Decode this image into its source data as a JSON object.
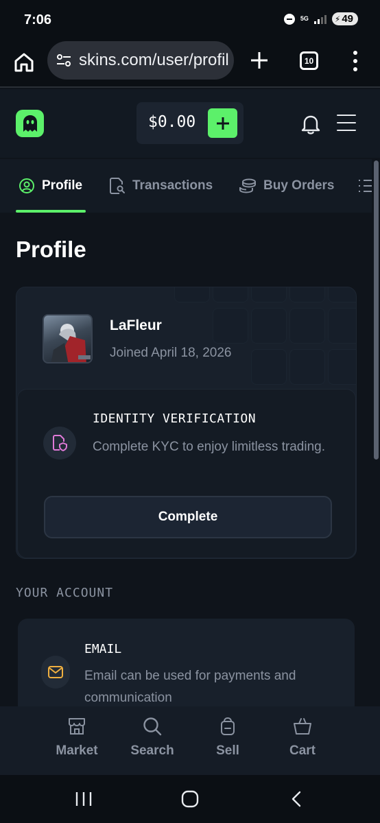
{
  "status": {
    "time": "7:06",
    "network": "5G",
    "battery": "49"
  },
  "browser": {
    "url": "skins.com/user/profil",
    "tab_count": "10"
  },
  "header": {
    "balance": "$0.00"
  },
  "tabs": [
    {
      "label": "Profile",
      "active": true,
      "icon": "user-circle-icon"
    },
    {
      "label": "Transactions",
      "active": false,
      "icon": "document-search-icon"
    },
    {
      "label": "Buy Orders",
      "active": false,
      "icon": "coins-icon"
    }
  ],
  "page": {
    "title": "Profile"
  },
  "profile": {
    "username": "LaFleur",
    "joined": "Joined April 18, 2026"
  },
  "kyc": {
    "title": "IDENTITY VERIFICATION",
    "description": "Complete KYC to enjoy limitless trading.",
    "button": "Complete"
  },
  "account": {
    "section_label": "YOUR ACCOUNT",
    "email_title": "EMAIL",
    "email_description": "Email can be used for payments and communication"
  },
  "bottom_nav": [
    {
      "label": "Market",
      "icon": "store-icon"
    },
    {
      "label": "Search",
      "icon": "search-icon"
    },
    {
      "label": "Sell",
      "icon": "sell-bag-icon"
    },
    {
      "label": "Cart",
      "icon": "basket-icon"
    }
  ],
  "colors": {
    "accent": "#5cf06a",
    "background": "#0f141b",
    "card": "#18202b",
    "muted_text": "#8b93a1"
  }
}
